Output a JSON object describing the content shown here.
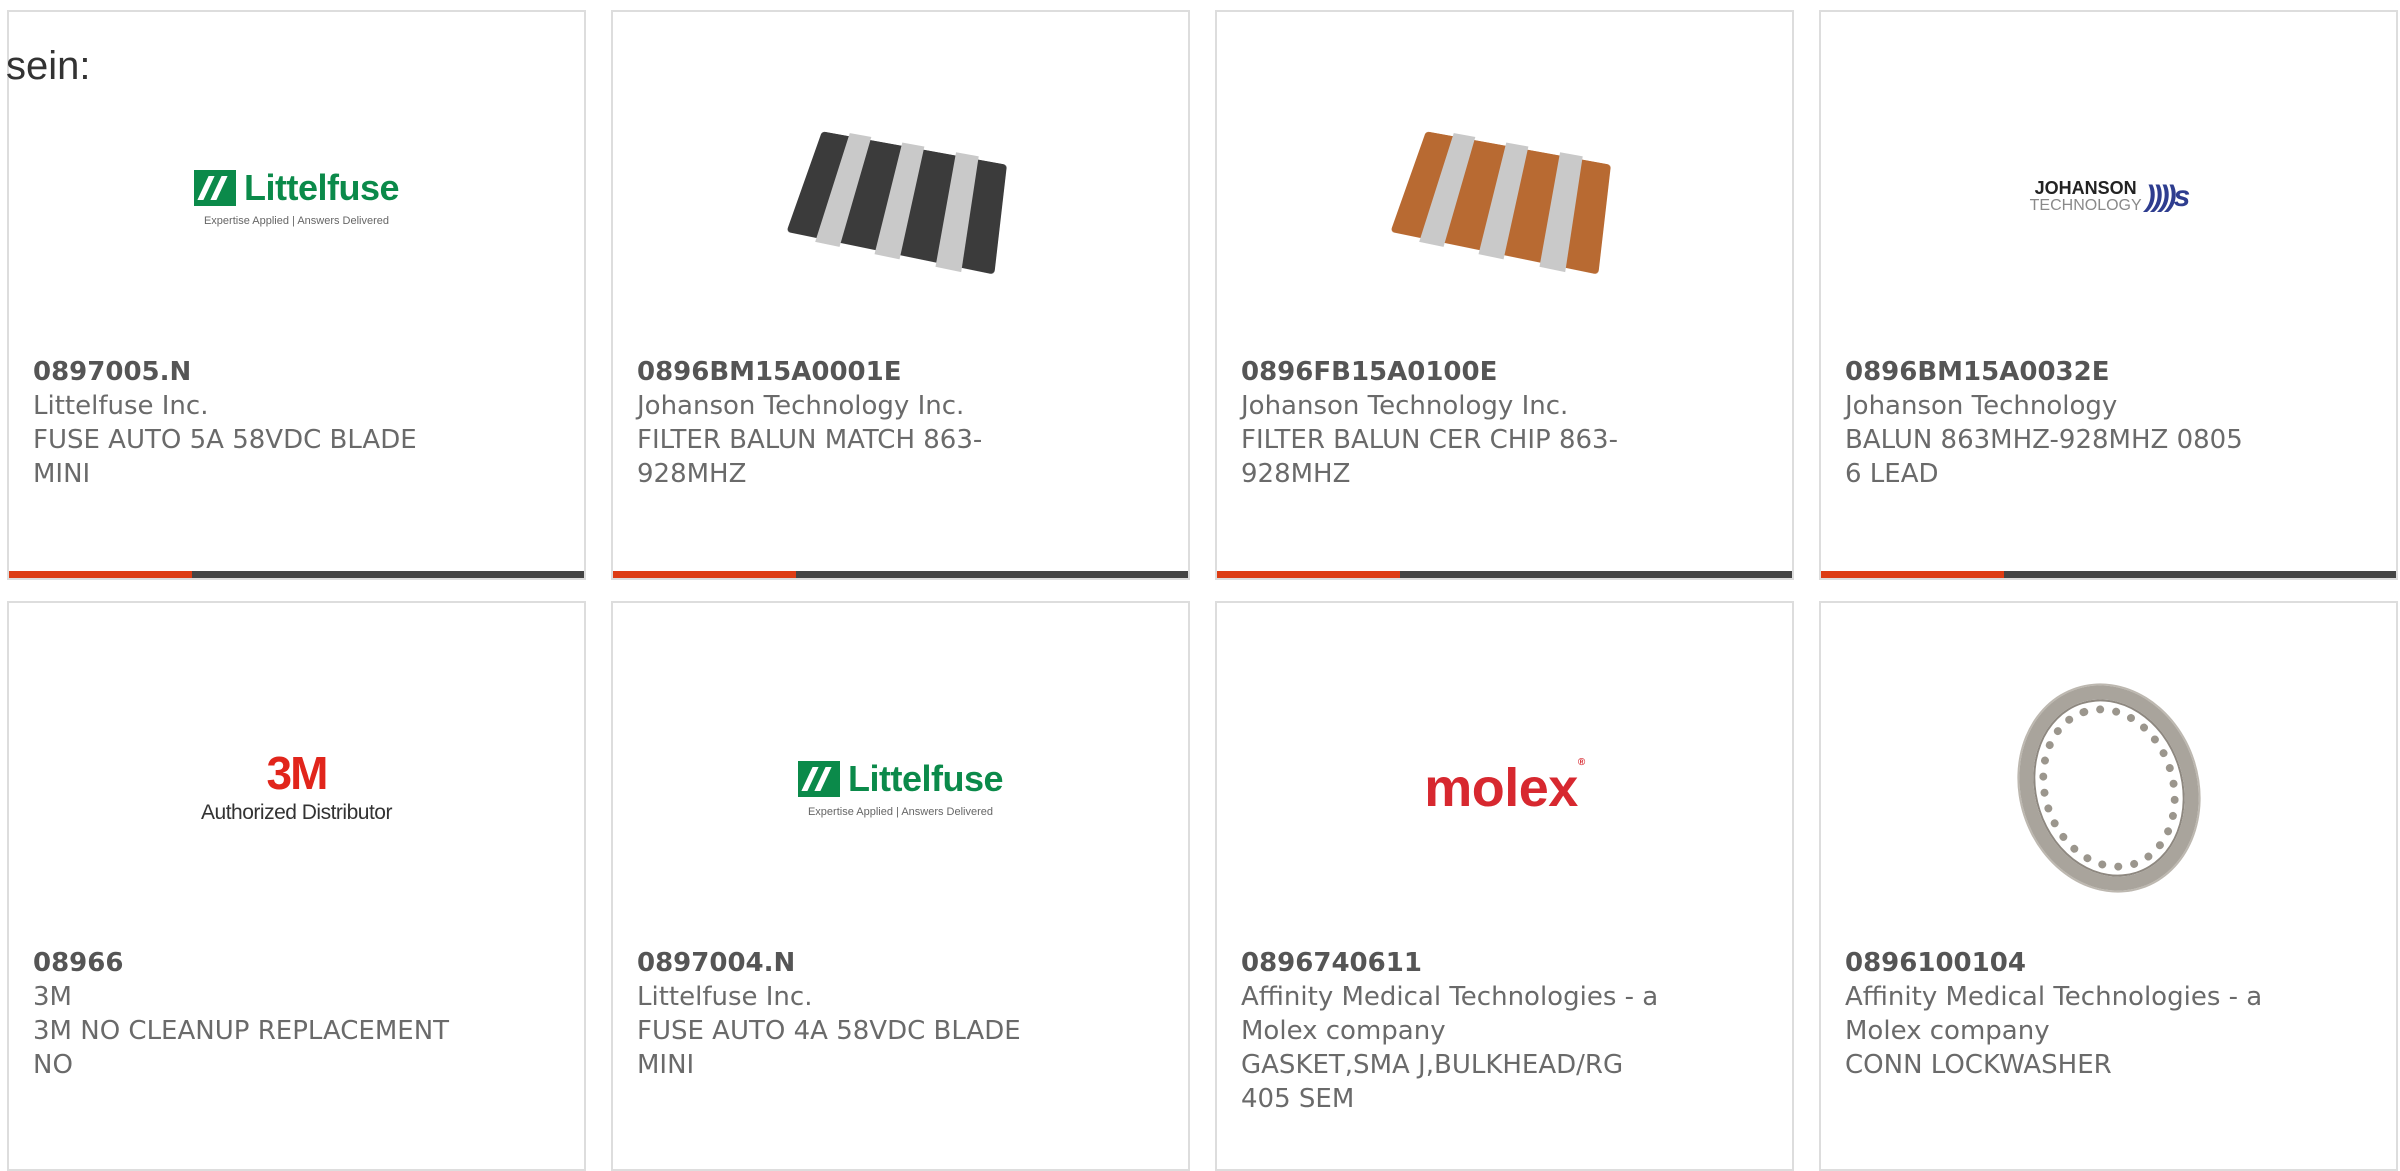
{
  "lead_text": "sein:",
  "colors": {
    "accent": "#dd3c14",
    "bar": "#444444",
    "border": "#dddddd"
  },
  "cards": [
    {
      "part_number": "0897005.N",
      "manufacturer": "Littelfuse Inc.",
      "description": "FUSE AUTO 5A 58VDC BLADE MINI",
      "image": "littelfuse-logo",
      "logo_name": "Littelfuse",
      "logo_tagline": "Expertise Applied | Answers Delivered"
    },
    {
      "part_number": "0896BM15A0001E",
      "manufacturer": "Johanson Technology Inc.",
      "description": "FILTER BALUN MATCH 863-928MHZ",
      "image": "black-chip-photo"
    },
    {
      "part_number": "0896FB15A0100E",
      "manufacturer": "Johanson Technology Inc.",
      "description": "FILTER BALUN CER CHIP 863-928MHZ",
      "image": "brown-chip-photo"
    },
    {
      "part_number": "0896BM15A0032E",
      "manufacturer": "Johanson Technology",
      "description": "BALUN 863MHZ-928MHZ 0805 6 LEAD",
      "image": "johanson-logo",
      "logo_line1": "JOHANSON",
      "logo_line2": "TECHNOLOGY"
    },
    {
      "part_number": "08966",
      "manufacturer": "3M",
      "description": "3M NO CLEANUP REPLACEMENT NO",
      "image": "3m-logo",
      "logo_name": "3M",
      "logo_tagline": "Authorized Distributor"
    },
    {
      "part_number": "0897004.N",
      "manufacturer": "Littelfuse Inc.",
      "description": "FUSE AUTO 4A 58VDC BLADE MINI",
      "image": "littelfuse-logo",
      "logo_name": "Littelfuse",
      "logo_tagline": "Expertise Applied | Answers Delivered"
    },
    {
      "part_number": "0896740611",
      "manufacturer": "Affinity Medical Technologies - a Molex company",
      "description": "GASKET,SMA J,BULKHEAD/RG 405 SEM",
      "image": "molex-logo",
      "logo_name": "molex"
    },
    {
      "part_number": "0896100104",
      "manufacturer": "Affinity Medical Technologies - a Molex company",
      "description": "CONN LOCKWASHER",
      "image": "lockwasher-photo"
    }
  ]
}
